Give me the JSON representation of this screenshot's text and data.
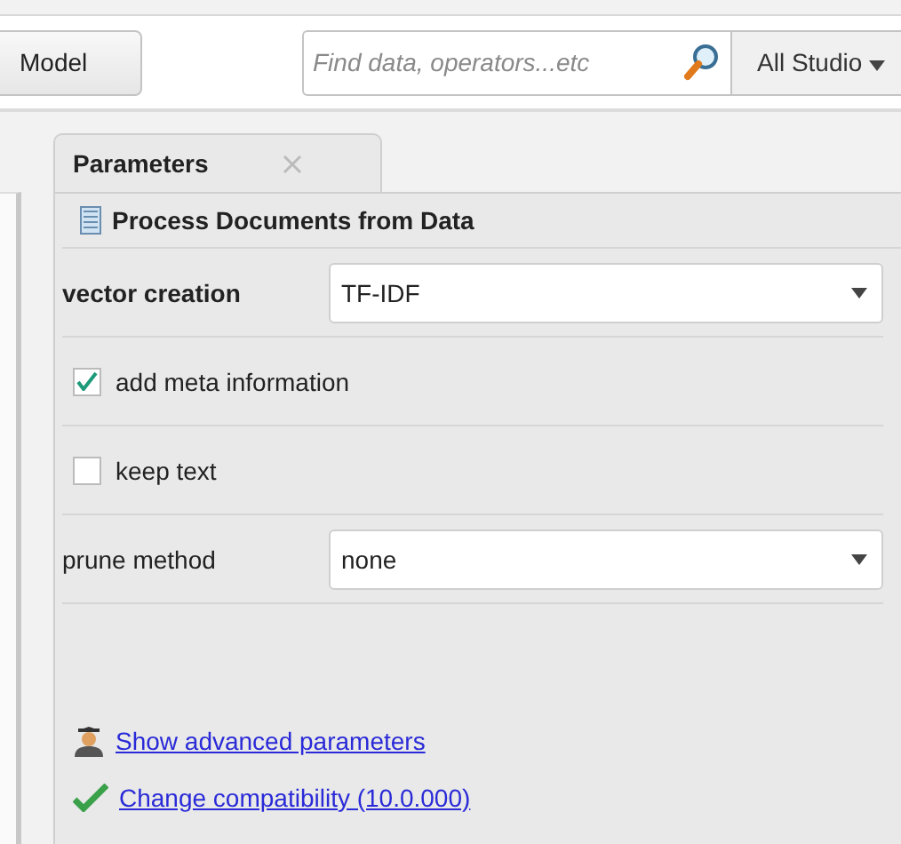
{
  "toolbar": {
    "button": "Model",
    "search": {
      "placeholder": "Find data, operators...etc"
    },
    "scope": "All Studio"
  },
  "tabs": [
    {
      "label": "Parameters",
      "selected": true
    }
  ],
  "operator": {
    "title": "Process Documents from Data"
  },
  "parameters": [
    {
      "kind": "select",
      "label": "vector creation",
      "bold": true,
      "value": "TF-IDF"
    },
    {
      "kind": "checkbox",
      "label": "add meta information",
      "checked": true
    },
    {
      "kind": "checkbox",
      "label": "keep text",
      "checked": false
    },
    {
      "kind": "select",
      "label": "prune method",
      "bold": false,
      "value": "none"
    }
  ],
  "links": [
    {
      "kind": "advanced",
      "text": "Show advanced parameters"
    },
    {
      "kind": "compat",
      "text": "Change compatibility (10.0.000)"
    }
  ]
}
